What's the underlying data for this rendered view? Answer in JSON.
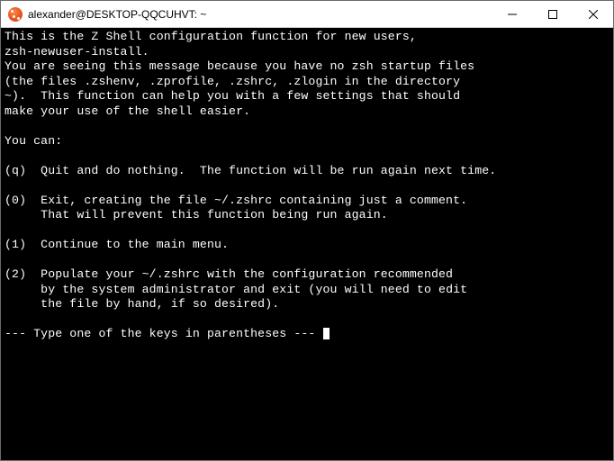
{
  "window": {
    "title": "alexander@DESKTOP-QQCUHVT: ~"
  },
  "terminal": {
    "lines": [
      "This is the Z Shell configuration function for new users,",
      "zsh-newuser-install.",
      "You are seeing this message because you have no zsh startup files",
      "(the files .zshenv, .zprofile, .zshrc, .zlogin in the directory",
      "~).  This function can help you with a few settings that should",
      "make your use of the shell easier.",
      "",
      "You can:",
      "",
      "(q)  Quit and do nothing.  The function will be run again next time.",
      "",
      "(0)  Exit, creating the file ~/.zshrc containing just a comment.",
      "     That will prevent this function being run again.",
      "",
      "(1)  Continue to the main menu.",
      "",
      "(2)  Populate your ~/.zshrc with the configuration recommended",
      "     by the system administrator and exit (you will need to edit",
      "     the file by hand, if so desired).",
      ""
    ],
    "prompt": "--- Type one of the keys in parentheses --- "
  }
}
